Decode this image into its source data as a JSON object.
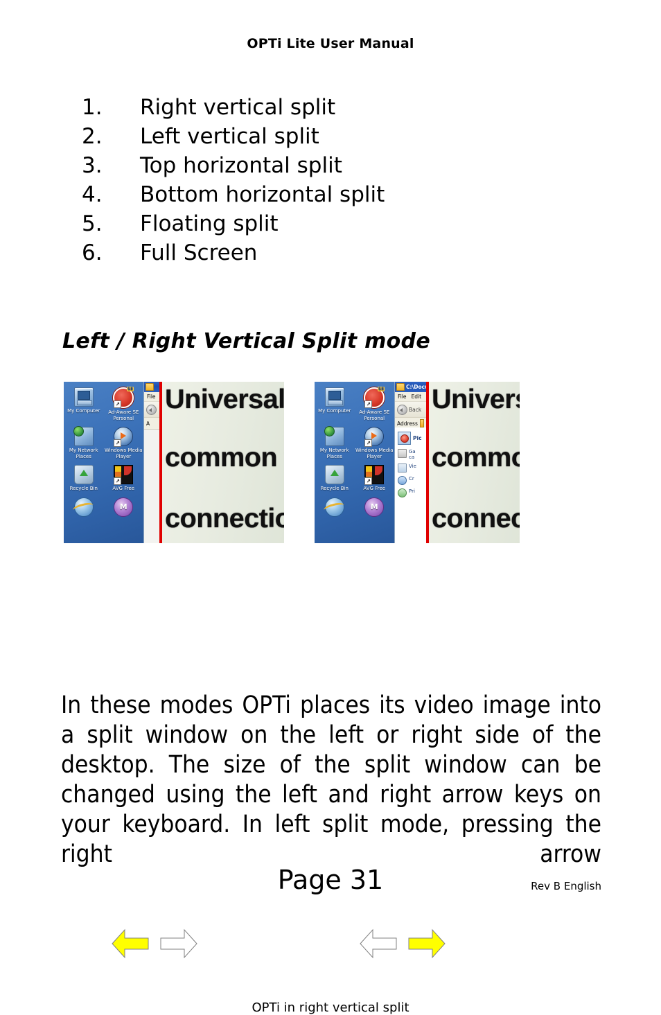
{
  "document": {
    "header_title": "OPTi Lite User Manual",
    "page_label": "Page 31",
    "revision": "Rev B English"
  },
  "split_modes": [
    {
      "number": "1.",
      "label": "Right vertical split"
    },
    {
      "number": "2.",
      "label": "Left vertical split"
    },
    {
      "number": "3.",
      "label": "Top horizontal split"
    },
    {
      "number": "4.",
      "label": "Bottom horizontal split"
    },
    {
      "number": "5.",
      "label": "Floating split"
    },
    {
      "number": "6.",
      "label": "Full Screen"
    }
  ],
  "section": {
    "heading": "Left / Right Vertical Split mode"
  },
  "figure": {
    "caption": "OPTi in right vertical split",
    "divider_color": "#e00000",
    "arrow_highlight_color": "#ffff00",
    "arrow_outline_color": "#808080",
    "left_screenshot": {
      "desktop_icons": [
        {
          "label": "My Computer",
          "icon": "my-computer-icon"
        },
        {
          "label": "Ad-Aware SE Personal",
          "icon": "ad-aware-icon"
        },
        {
          "label": "My Network Places",
          "icon": "my-network-places-icon"
        },
        {
          "label": "Windows Media Player",
          "icon": "windows-media-player-icon"
        },
        {
          "label": "Recycle Bin",
          "icon": "recycle-bin-icon"
        },
        {
          "label": "AVG Free",
          "icon": "avg-free-icon"
        }
      ],
      "magnified_lines": [
        "Universal Seria",
        "common type",
        "connection an"
      ]
    },
    "right_screenshot": {
      "desktop_icons": [
        {
          "label": "My Computer",
          "icon": "my-computer-icon"
        },
        {
          "label": "Ad-Aware SE Personal",
          "icon": "ad-aware-icon"
        },
        {
          "label": "My Network Places",
          "icon": "my-network-places-icon"
        },
        {
          "label": "Windows Media Player",
          "icon": "windows-media-player-icon"
        },
        {
          "label": "Recycle Bin",
          "icon": "recycle-bin-icon"
        },
        {
          "label": "AVG Free",
          "icon": "avg-free-icon"
        }
      ],
      "explorer": {
        "title": "C:\\Docu",
        "menu": [
          "File",
          "Edit"
        ],
        "back_button": "Back",
        "address_label": "Address",
        "task_pane_title": "Pic",
        "tasks": [
          {
            "line1": "Ga",
            "line2": "ca"
          },
          {
            "line1": "Vie",
            "line2": ""
          },
          {
            "line1": "Cr",
            "line2": ""
          },
          {
            "line1": "Pri",
            "line2": ""
          }
        ]
      },
      "magnified_lines": [
        "Universal Se",
        "common typ",
        "connection a"
      ]
    },
    "left_arrows": [
      {
        "direction": "left",
        "state": "highlighted"
      },
      {
        "direction": "right",
        "state": "outline"
      }
    ],
    "right_arrows": [
      {
        "direction": "left",
        "state": "outline"
      },
      {
        "direction": "right",
        "state": "highlighted"
      }
    ]
  },
  "body": {
    "paragraph": "In these modes OPTi places its video image into a split window on the left or right side of the desktop. The size of the split window can be changed using the left and right arrow keys on your keyboard. In left split mode, pressing the right arrow"
  }
}
